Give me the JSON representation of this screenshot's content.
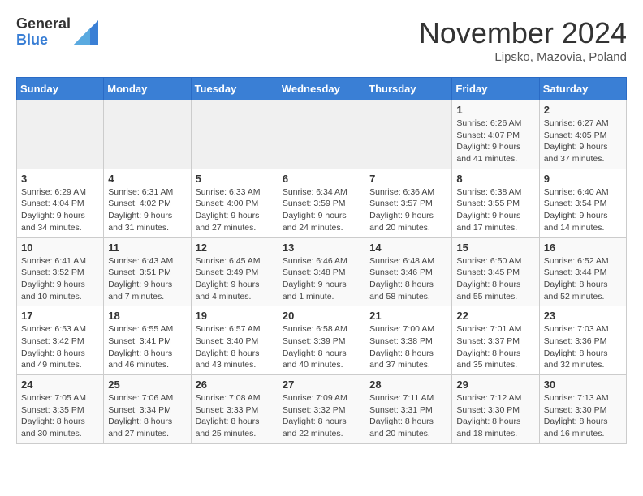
{
  "logo": {
    "general": "General",
    "blue": "Blue"
  },
  "title": "November 2024",
  "subtitle": "Lipsko, Mazovia, Poland",
  "days_of_week": [
    "Sunday",
    "Monday",
    "Tuesday",
    "Wednesday",
    "Thursday",
    "Friday",
    "Saturday"
  ],
  "weeks": [
    [
      {
        "day": "",
        "info": ""
      },
      {
        "day": "",
        "info": ""
      },
      {
        "day": "",
        "info": ""
      },
      {
        "day": "",
        "info": ""
      },
      {
        "day": "",
        "info": ""
      },
      {
        "day": "1",
        "info": "Sunrise: 6:26 AM\nSunset: 4:07 PM\nDaylight: 9 hours\nand 41 minutes."
      },
      {
        "day": "2",
        "info": "Sunrise: 6:27 AM\nSunset: 4:05 PM\nDaylight: 9 hours\nand 37 minutes."
      }
    ],
    [
      {
        "day": "3",
        "info": "Sunrise: 6:29 AM\nSunset: 4:04 PM\nDaylight: 9 hours\nand 34 minutes."
      },
      {
        "day": "4",
        "info": "Sunrise: 6:31 AM\nSunset: 4:02 PM\nDaylight: 9 hours\nand 31 minutes."
      },
      {
        "day": "5",
        "info": "Sunrise: 6:33 AM\nSunset: 4:00 PM\nDaylight: 9 hours\nand 27 minutes."
      },
      {
        "day": "6",
        "info": "Sunrise: 6:34 AM\nSunset: 3:59 PM\nDaylight: 9 hours\nand 24 minutes."
      },
      {
        "day": "7",
        "info": "Sunrise: 6:36 AM\nSunset: 3:57 PM\nDaylight: 9 hours\nand 20 minutes."
      },
      {
        "day": "8",
        "info": "Sunrise: 6:38 AM\nSunset: 3:55 PM\nDaylight: 9 hours\nand 17 minutes."
      },
      {
        "day": "9",
        "info": "Sunrise: 6:40 AM\nSunset: 3:54 PM\nDaylight: 9 hours\nand 14 minutes."
      }
    ],
    [
      {
        "day": "10",
        "info": "Sunrise: 6:41 AM\nSunset: 3:52 PM\nDaylight: 9 hours\nand 10 minutes."
      },
      {
        "day": "11",
        "info": "Sunrise: 6:43 AM\nSunset: 3:51 PM\nDaylight: 9 hours\nand 7 minutes."
      },
      {
        "day": "12",
        "info": "Sunrise: 6:45 AM\nSunset: 3:49 PM\nDaylight: 9 hours\nand 4 minutes."
      },
      {
        "day": "13",
        "info": "Sunrise: 6:46 AM\nSunset: 3:48 PM\nDaylight: 9 hours\nand 1 minute."
      },
      {
        "day": "14",
        "info": "Sunrise: 6:48 AM\nSunset: 3:46 PM\nDaylight: 8 hours\nand 58 minutes."
      },
      {
        "day": "15",
        "info": "Sunrise: 6:50 AM\nSunset: 3:45 PM\nDaylight: 8 hours\nand 55 minutes."
      },
      {
        "day": "16",
        "info": "Sunrise: 6:52 AM\nSunset: 3:44 PM\nDaylight: 8 hours\nand 52 minutes."
      }
    ],
    [
      {
        "day": "17",
        "info": "Sunrise: 6:53 AM\nSunset: 3:42 PM\nDaylight: 8 hours\nand 49 minutes."
      },
      {
        "day": "18",
        "info": "Sunrise: 6:55 AM\nSunset: 3:41 PM\nDaylight: 8 hours\nand 46 minutes."
      },
      {
        "day": "19",
        "info": "Sunrise: 6:57 AM\nSunset: 3:40 PM\nDaylight: 8 hours\nand 43 minutes."
      },
      {
        "day": "20",
        "info": "Sunrise: 6:58 AM\nSunset: 3:39 PM\nDaylight: 8 hours\nand 40 minutes."
      },
      {
        "day": "21",
        "info": "Sunrise: 7:00 AM\nSunset: 3:38 PM\nDaylight: 8 hours\nand 37 minutes."
      },
      {
        "day": "22",
        "info": "Sunrise: 7:01 AM\nSunset: 3:37 PM\nDaylight: 8 hours\nand 35 minutes."
      },
      {
        "day": "23",
        "info": "Sunrise: 7:03 AM\nSunset: 3:36 PM\nDaylight: 8 hours\nand 32 minutes."
      }
    ],
    [
      {
        "day": "24",
        "info": "Sunrise: 7:05 AM\nSunset: 3:35 PM\nDaylight: 8 hours\nand 30 minutes."
      },
      {
        "day": "25",
        "info": "Sunrise: 7:06 AM\nSunset: 3:34 PM\nDaylight: 8 hours\nand 27 minutes."
      },
      {
        "day": "26",
        "info": "Sunrise: 7:08 AM\nSunset: 3:33 PM\nDaylight: 8 hours\nand 25 minutes."
      },
      {
        "day": "27",
        "info": "Sunrise: 7:09 AM\nSunset: 3:32 PM\nDaylight: 8 hours\nand 22 minutes."
      },
      {
        "day": "28",
        "info": "Sunrise: 7:11 AM\nSunset: 3:31 PM\nDaylight: 8 hours\nand 20 minutes."
      },
      {
        "day": "29",
        "info": "Sunrise: 7:12 AM\nSunset: 3:30 PM\nDaylight: 8 hours\nand 18 minutes."
      },
      {
        "day": "30",
        "info": "Sunrise: 7:13 AM\nSunset: 3:30 PM\nDaylight: 8 hours\nand 16 minutes."
      }
    ]
  ]
}
